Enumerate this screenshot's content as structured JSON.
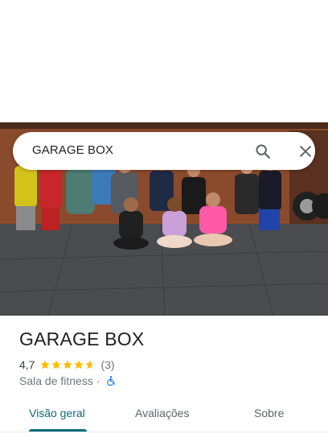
{
  "search": {
    "query": "GARAGE BOX",
    "search_icon": "search-icon",
    "close_icon": "close-icon"
  },
  "hero": {
    "description_icon": "photo"
  },
  "place": {
    "name": "GARAGE BOX",
    "rating": "4,7",
    "stars": 4.5,
    "review_count": "(3)",
    "category": "Sala de fitness",
    "separator": "·",
    "accessibility_icon": "wheelchair-icon",
    "accent_color": "#1a73e8",
    "star_color": "#fbbc04"
  },
  "tabs": [
    {
      "label": "Visão geral",
      "active": true
    },
    {
      "label": "Avaliações",
      "active": false
    },
    {
      "label": "Sobre",
      "active": false
    }
  ],
  "colors": {
    "active_tab": "#0b6b7a",
    "inactive_tab": "#5f6368"
  }
}
